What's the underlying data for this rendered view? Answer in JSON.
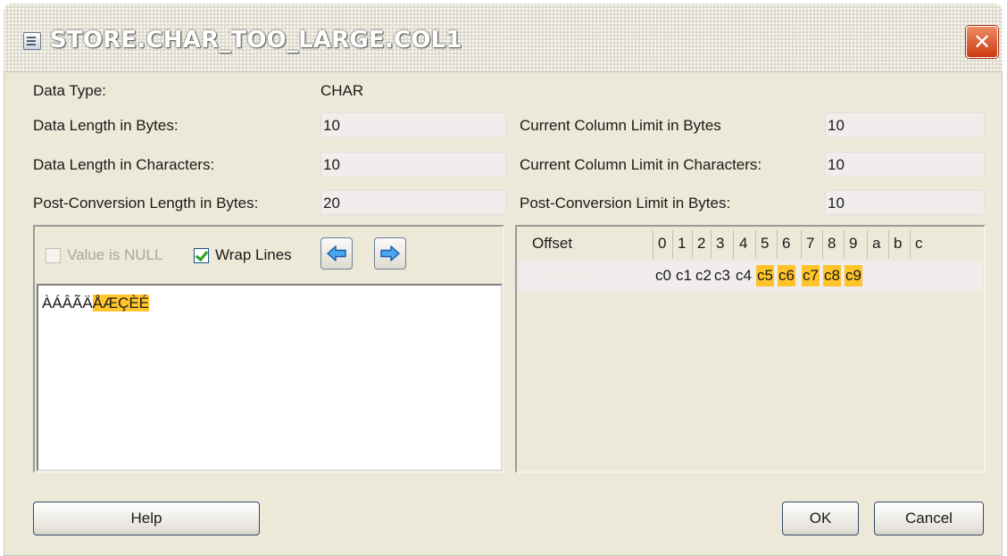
{
  "title": "STORE.CHAR_TOO_LARGE.COL1",
  "close_glyph": "✕",
  "info": {
    "data_type_label": "Data Type:",
    "data_type_value": "CHAR",
    "data_len_bytes_label": "Data Length in Bytes:",
    "data_len_bytes_value": "10",
    "data_len_chars_label": "Data Length in Characters:",
    "data_len_chars_value": "10",
    "post_conv_len_label": "Post-Conversion Length in Bytes:",
    "post_conv_len_value": "20",
    "col_limit_bytes_label": "Current Column Limit in Bytes",
    "col_limit_bytes_value": "10",
    "col_limit_chars_label": "Current Column Limit in Characters:",
    "col_limit_chars_value": "10",
    "post_conv_limit_label": "Post-Conversion Limit in Bytes:",
    "post_conv_limit_value": "10"
  },
  "text_panel": {
    "value_is_null_label": "Value is NULL",
    "value_is_null_checked": false,
    "wrap_lines_label": "Wrap Lines",
    "wrap_lines_checked": true,
    "text_normal": "ÀÁÂÃÄ",
    "text_highlighted": "ÅÆÇÈÉ",
    "highlight_color": "#ffc42a"
  },
  "hex_panel": {
    "offset_header": "Offset",
    "columns": [
      "0",
      "1",
      "2",
      "3",
      "4",
      "5",
      "6",
      "7",
      "8",
      "9",
      "a",
      "b",
      "c"
    ],
    "row": {
      "offset": "00000000",
      "bytes": [
        "c0",
        "c1",
        "c2",
        "c3",
        "c4",
        "c5",
        "c6",
        "c7",
        "c8",
        "c9"
      ],
      "highlighted_bytes": [
        "c5",
        "c6",
        "c7",
        "c8",
        "c9"
      ]
    }
  },
  "buttons": {
    "help": "Help",
    "ok": "OK",
    "cancel": "Cancel"
  },
  "icons": {
    "title": "table-column-icon",
    "prev": "arrow-left-icon",
    "next": "arrow-right-icon"
  }
}
